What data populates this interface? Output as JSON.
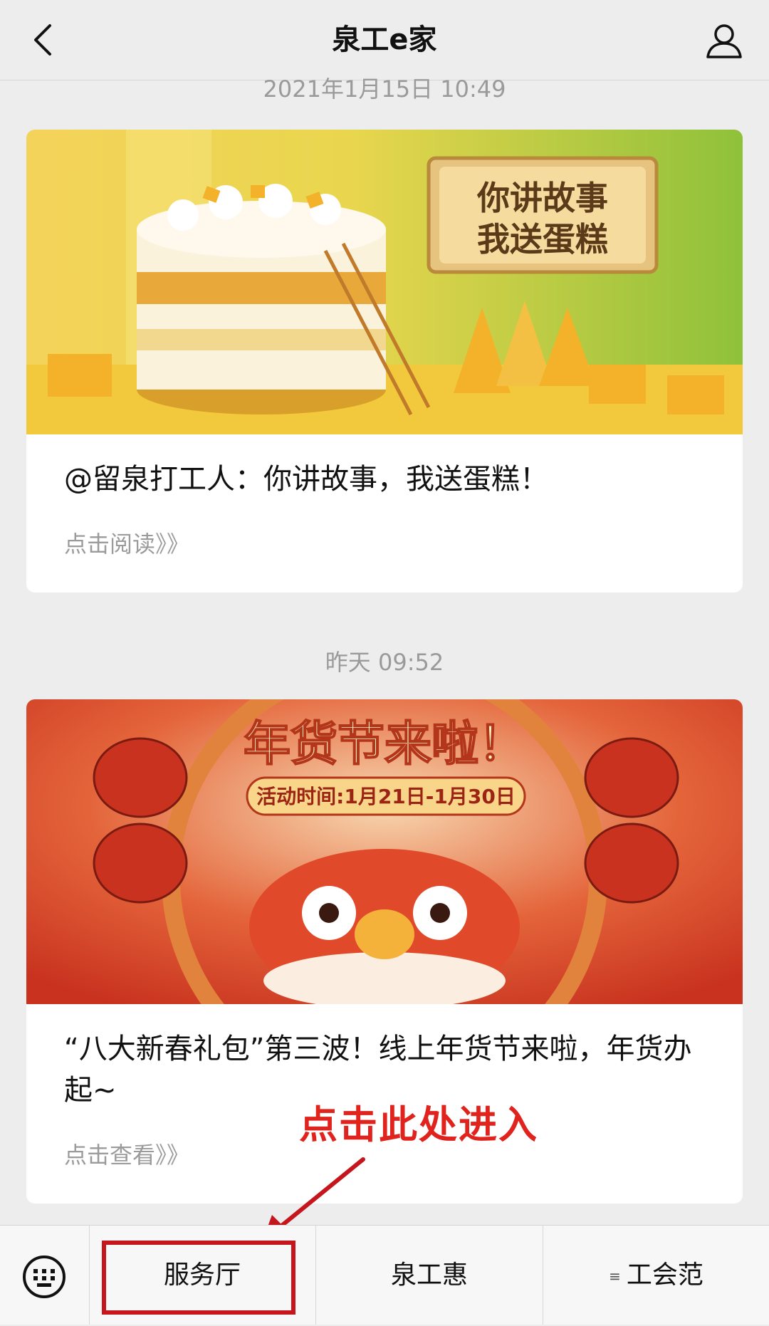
{
  "header": {
    "title": "泉工e家",
    "back_icon": "chevron-left-icon",
    "profile_icon": "user-icon"
  },
  "messages": [
    {
      "timestamp": "2021年1月15日 10:49",
      "cover": {
        "banner_line1": "你讲故事",
        "banner_line2": "我送蛋糕"
      },
      "headline": "@留泉打工人：你讲故事，我送蛋糕！",
      "link": "点击阅读》》"
    },
    {
      "timestamp": "昨天 09:52",
      "cover": {
        "banner_title": "年货节来啦！",
        "banner_subtitle": "活动时间:1月21日-1月30日"
      },
      "headline": "“八大新春礼包”第三波！线上年货节来啦，年货办起~",
      "link": "点击查看》》"
    }
  ],
  "annotation": {
    "callout": "点击此处进入"
  },
  "menu": {
    "keyboard_icon": "keyboard-icon",
    "items": [
      {
        "label": "服务厅"
      },
      {
        "label": "泉工惠"
      },
      {
        "label": "工会范"
      }
    ]
  },
  "colors": {
    "accent_red": "#e0231c",
    "cake_green": "#9cc33b",
    "festival_red": "#c8321f"
  }
}
